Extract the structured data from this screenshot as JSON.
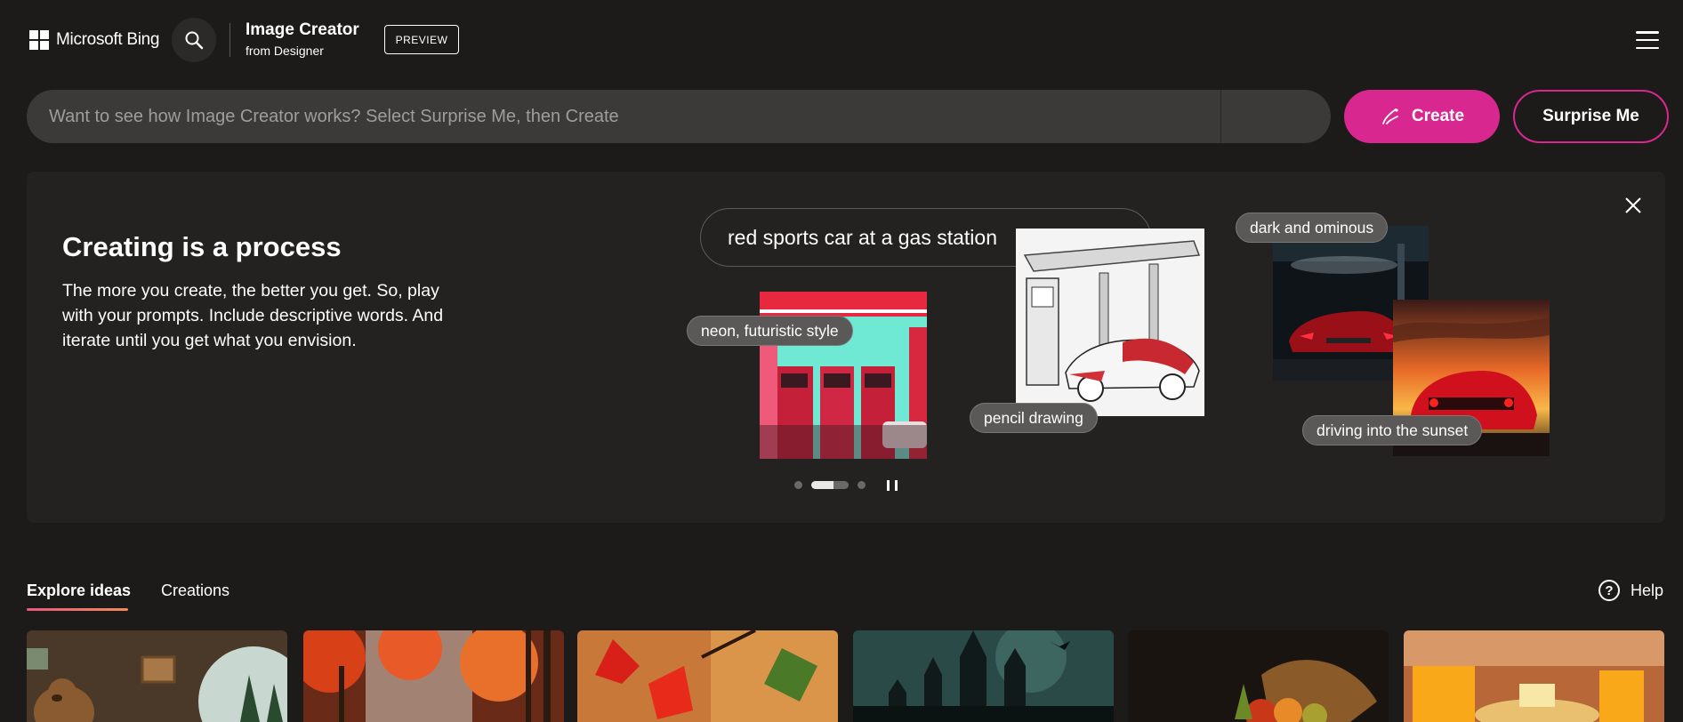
{
  "header": {
    "brand": "Microsoft Bing",
    "app_title": "Image Creator",
    "app_subtitle": "from Designer",
    "preview_badge": "PREVIEW"
  },
  "prompt": {
    "placeholder": "Want to see how Image Creator works? Select Surprise Me, then Create",
    "value": "",
    "create_label": "Create",
    "surprise_label": "Surprise Me"
  },
  "banner": {
    "title": "Creating is a process",
    "body": "The more you create, the better you get. So, play with your prompts. Include descriptive words. And iterate until you get what you envision.",
    "example_prompt": "red sports car at a gas station",
    "tags": {
      "neon": "neon, futuristic style",
      "pencil": "pencil drawing",
      "dark": "dark and ominous",
      "sunset": "driving into the sunset"
    },
    "carousel": {
      "slides": 3,
      "active_slide": 2
    }
  },
  "tabs": {
    "explore": "Explore ideas",
    "creations": "Creations",
    "help": "Help"
  },
  "colors": {
    "accent": "#d8278f",
    "background": "#1c1b1a",
    "banner": "#232221"
  },
  "icons": [
    "search-icon",
    "menu-icon",
    "close-icon",
    "create-brush-icon",
    "pause-icon",
    "help-icon"
  ]
}
